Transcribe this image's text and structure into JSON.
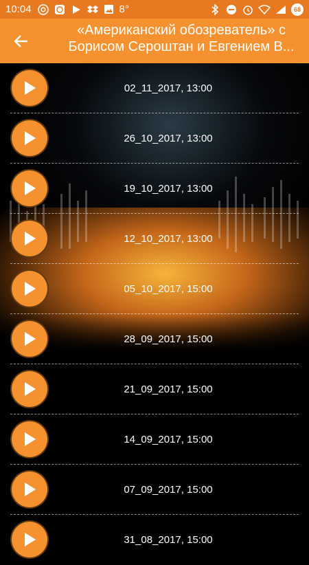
{
  "status_bar": {
    "time": "10:04",
    "temperature": "8°",
    "battery_level": "68",
    "left_icons": [
      "chrome-icon",
      "face-app-icon",
      "play-store-icon",
      "dropbox-icon",
      "image-icon"
    ],
    "right_icons": [
      "bluetooth-icon",
      "do-not-disturb-icon",
      "alarm-icon",
      "wifi-icon",
      "signal-icon"
    ]
  },
  "app_bar": {
    "title": "«Американский обозреватель» с Борисом Сероштан и Евгением В..."
  },
  "colors": {
    "accent": "#f6912f",
    "status_bar": "#e77920",
    "background": "#000000",
    "text": "#ffffff"
  },
  "episodes": [
    {
      "label": "02_11_2017, 13:00"
    },
    {
      "label": "26_10_2017, 13:00"
    },
    {
      "label": "19_10_2017, 13:00"
    },
    {
      "label": "12_10_2017, 13:00"
    },
    {
      "label": "05_10_2017, 15:00"
    },
    {
      "label": "28_09_2017, 15:00"
    },
    {
      "label": "21_09_2017, 15:00"
    },
    {
      "label": "14_09_2017, 15:00"
    },
    {
      "label": "07_09_2017, 15:00"
    },
    {
      "label": "31_08_2017, 15:00"
    }
  ]
}
